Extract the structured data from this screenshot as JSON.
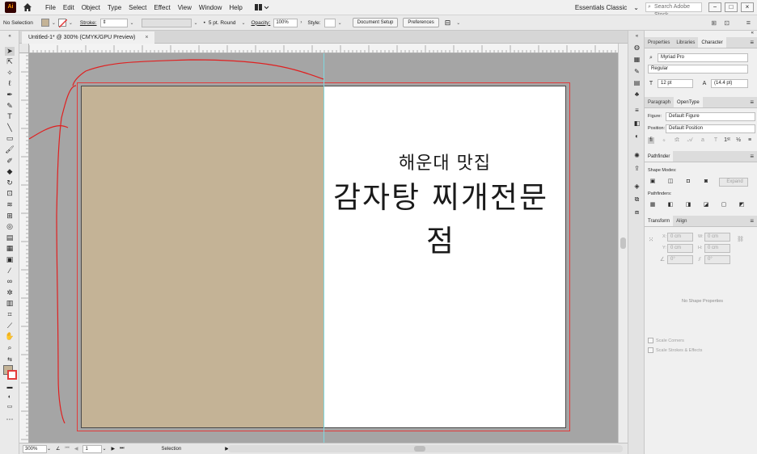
{
  "app": {
    "logo": "Ai",
    "menu": [
      "File",
      "Edit",
      "Object",
      "Type",
      "Select",
      "Effect",
      "View",
      "Window",
      "Help"
    ],
    "workspace": "Essentials Classic",
    "search_placeholder": "Search Adobe Stock"
  },
  "controlbar": {
    "selection_label": "No Selection",
    "stroke_label": "Stroke:",
    "brush_label": "5 pt. Round",
    "opacity_label": "Opacity:",
    "opacity_value": "100%",
    "style_label": "Style:",
    "document_setup": "Document Setup",
    "preferences": "Preferences"
  },
  "document": {
    "tab_title": "Untitled-1* @ 300% (CMYK/GPU Preview)",
    "close": "×",
    "subtitle_text": "해운대 맛집",
    "title_text": "감자탕 찌개전문점",
    "colors": {
      "left_page": "#c4b396",
      "right_page": "#ffffff",
      "bleed": "#e33a3a",
      "pasteboard": "#a5a5a5",
      "sketch": "#e02020"
    }
  },
  "status": {
    "zoom": "300%",
    "artboard": "1",
    "tool": "Selection"
  },
  "panels": {
    "tabs1": [
      "Properties",
      "Libraries",
      "Character"
    ],
    "font_family": "Myriad Pro",
    "font_style": "Regular",
    "font_size": "12 pt",
    "leading": "(14.4 pt)",
    "tabs2": [
      "Paragraph",
      "OpenType"
    ],
    "figure_label": "Figure:",
    "figure_value": "Default Figure",
    "position_label": "Position:",
    "position_value": "Default Position",
    "pathfinder_tab": "Pathfinder",
    "shape_modes": "Shape Modes:",
    "expand": "Expand",
    "pathfinders": "Pathfinders:",
    "tabs3": [
      "Transform",
      "Align"
    ],
    "x_label": "X:",
    "y_label": "Y:",
    "w_label": "W:",
    "h_label": "H:",
    "zero_cm": "0 cm",
    "zero_deg": "0°",
    "no_shape": "No Shape Properties",
    "scale_corners": "Scale Corners",
    "scale_strokes": "Scale Strokes & Effects"
  }
}
